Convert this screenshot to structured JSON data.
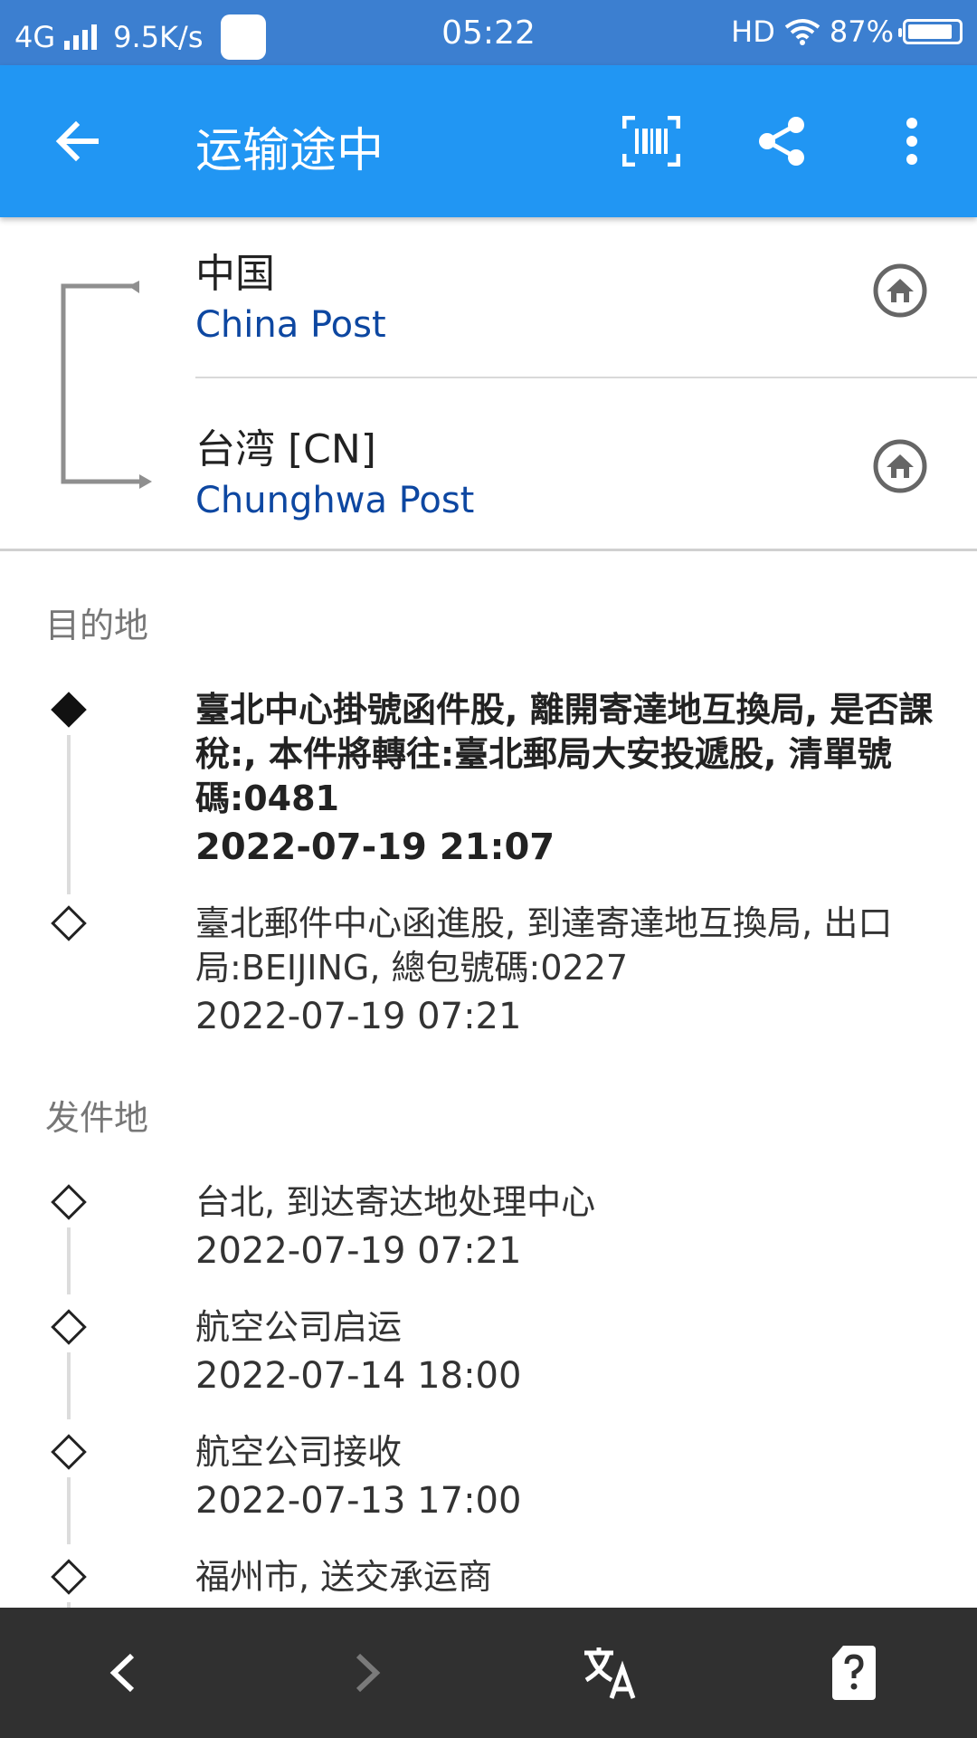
{
  "status": {
    "network": "4G",
    "speed": "9.5K/s",
    "time": "05:22",
    "hd": "HD",
    "battery": "87%"
  },
  "toolbar": {
    "title": "运输途中",
    "icons": [
      "back-arrow-icon",
      "barcode-icon",
      "share-icon",
      "more-vert-icon"
    ]
  },
  "route": {
    "origin": {
      "country": "中国",
      "carrier": "China Post"
    },
    "destination": {
      "country": "台湾 [CN]",
      "carrier": "Chunghwa Post"
    }
  },
  "sections": {
    "destination_label": "目的地",
    "origin_label": "发件地"
  },
  "destination_events": [
    {
      "desc": "臺北中心掛號函件股, 離開寄達地互換局, 是否課稅:, 本件將轉往:臺北郵局大安投遞股, 清單號碼:0481",
      "date": "2022-07-19 21:07"
    },
    {
      "desc": "臺北郵件中心函進股, 到達寄達地互換局, 出口局:BEIJING, 總包號碼:0227",
      "date": "2022-07-19 07:21"
    }
  ],
  "origin_events": [
    {
      "desc": "台北, 到达寄达地处理中心",
      "date": "2022-07-19 07:21"
    },
    {
      "desc": "航空公司启运",
      "date": "2022-07-14 18:00"
    },
    {
      "desc": "航空公司接收",
      "date": "2022-07-13 17:00"
    },
    {
      "desc": "福州市, 送交承运商",
      "date": ""
    }
  ],
  "bottom_nav": {
    "icons": [
      "prev-chevron-icon",
      "next-chevron-icon",
      "translate-icon",
      "help-card-icon"
    ]
  },
  "colors": {
    "status_bar": "#3c7fd0",
    "app_bar": "#2196f3",
    "carrier_link": "#0d47a1",
    "bottom_bar": "#303030"
  }
}
